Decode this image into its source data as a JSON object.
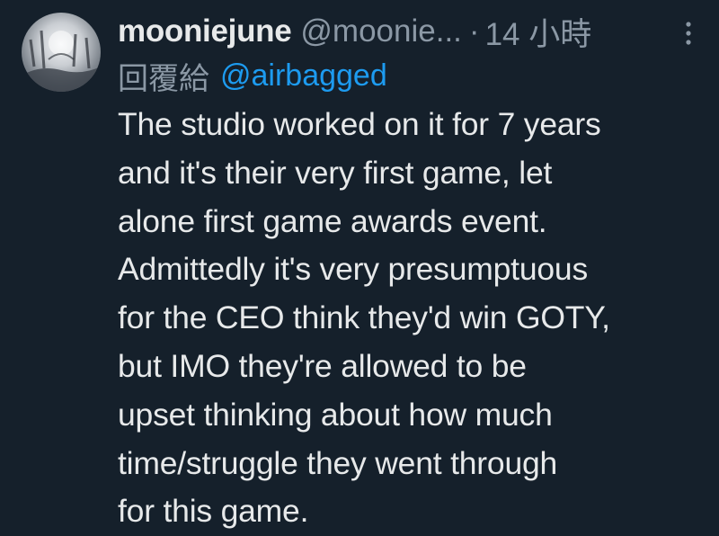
{
  "author": {
    "display_name": "mooniejune",
    "handle": "@moonie...",
    "separator": "·",
    "timestamp": "14 小時"
  },
  "reply": {
    "prefix": "回覆給",
    "mention": "@airbagged"
  },
  "body_lines": [
    "The studio worked on it for 7 years",
    "and it's their very first game, let",
    "alone first game awards event.",
    "Admittedly it's very presumptuous",
    "for the CEO think they'd win GOTY,",
    "but IMO they're allowed to be",
    "upset thinking about how much",
    "time/struggle they went through",
    "for this game."
  ],
  "icons": {
    "more": "more-vertical-icon"
  },
  "colors": {
    "background": "#15202b",
    "text_primary": "#e7e9ea",
    "text_secondary": "#8b98a5",
    "accent": "#1d9bf0"
  }
}
